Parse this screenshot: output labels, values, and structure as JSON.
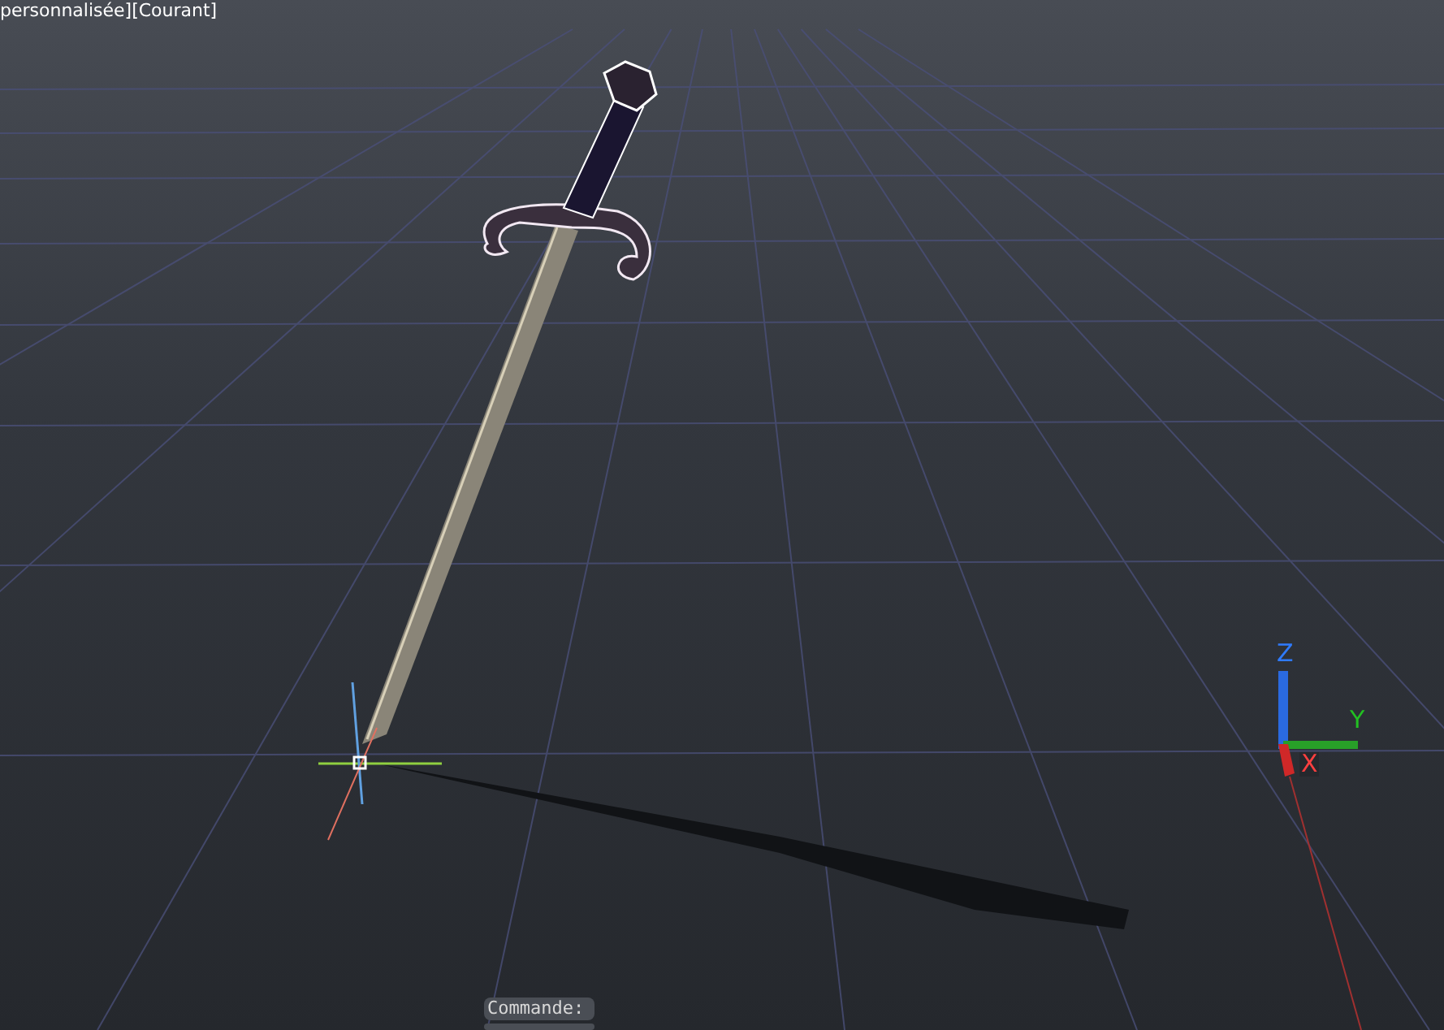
{
  "viewport": {
    "label": "personnalisée][Courant]"
  },
  "ucs_icon": {
    "axes": [
      {
        "label": "Z",
        "kind": "z"
      },
      {
        "label": "Y",
        "kind": "y"
      },
      {
        "label": "X",
        "kind": "x"
      }
    ]
  },
  "command_line": {
    "prompt": "Commande:"
  }
}
